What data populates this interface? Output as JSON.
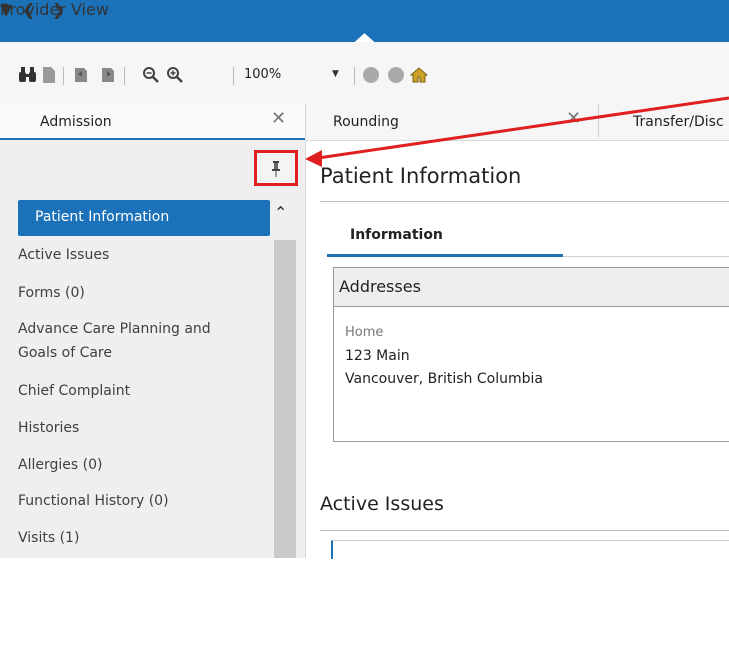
{
  "window": {
    "title": "Provider View",
    "icons": [
      "back-arrow-icon",
      "forward-arrow-icon",
      "dropdown-icon",
      "home-icon"
    ]
  },
  "toolbar": {
    "zoom_value": "100%",
    "icons": [
      "binoculars-icon",
      "page-icon",
      "print-icon",
      "copy-icon",
      "zoom-out-icon",
      "zoom-in-icon",
      "circle-icon",
      "circle-icon",
      "home-icon"
    ]
  },
  "tabs": [
    {
      "label": "Admission",
      "active": true
    },
    {
      "label": "Rounding",
      "active": false
    },
    {
      "label": "Transfer/Disc",
      "active": false
    }
  ],
  "sidebar": {
    "items": [
      {
        "label": "Patient Information",
        "active": true
      },
      {
        "label": "Active Issues"
      },
      {
        "label": "Forms (0)"
      },
      {
        "label": "Advance Care Planning and"
      },
      {
        "label": "Goals of Care"
      },
      {
        "label": "Chief Complaint"
      },
      {
        "label": "Histories"
      },
      {
        "label": "Allergies (0)"
      },
      {
        "label": "Functional History (0)"
      },
      {
        "label": "Visits (1)"
      }
    ]
  },
  "main": {
    "section_title": "Patient Information",
    "subtab": "Information",
    "addresses": {
      "header": "Addresses",
      "type": "Home",
      "street": "123 Main",
      "city": "Vancouver, British Columbia"
    },
    "issues_title": "Active Issues"
  },
  "colors": {
    "brand": "#1b72b8",
    "annotation": "#e02020"
  }
}
